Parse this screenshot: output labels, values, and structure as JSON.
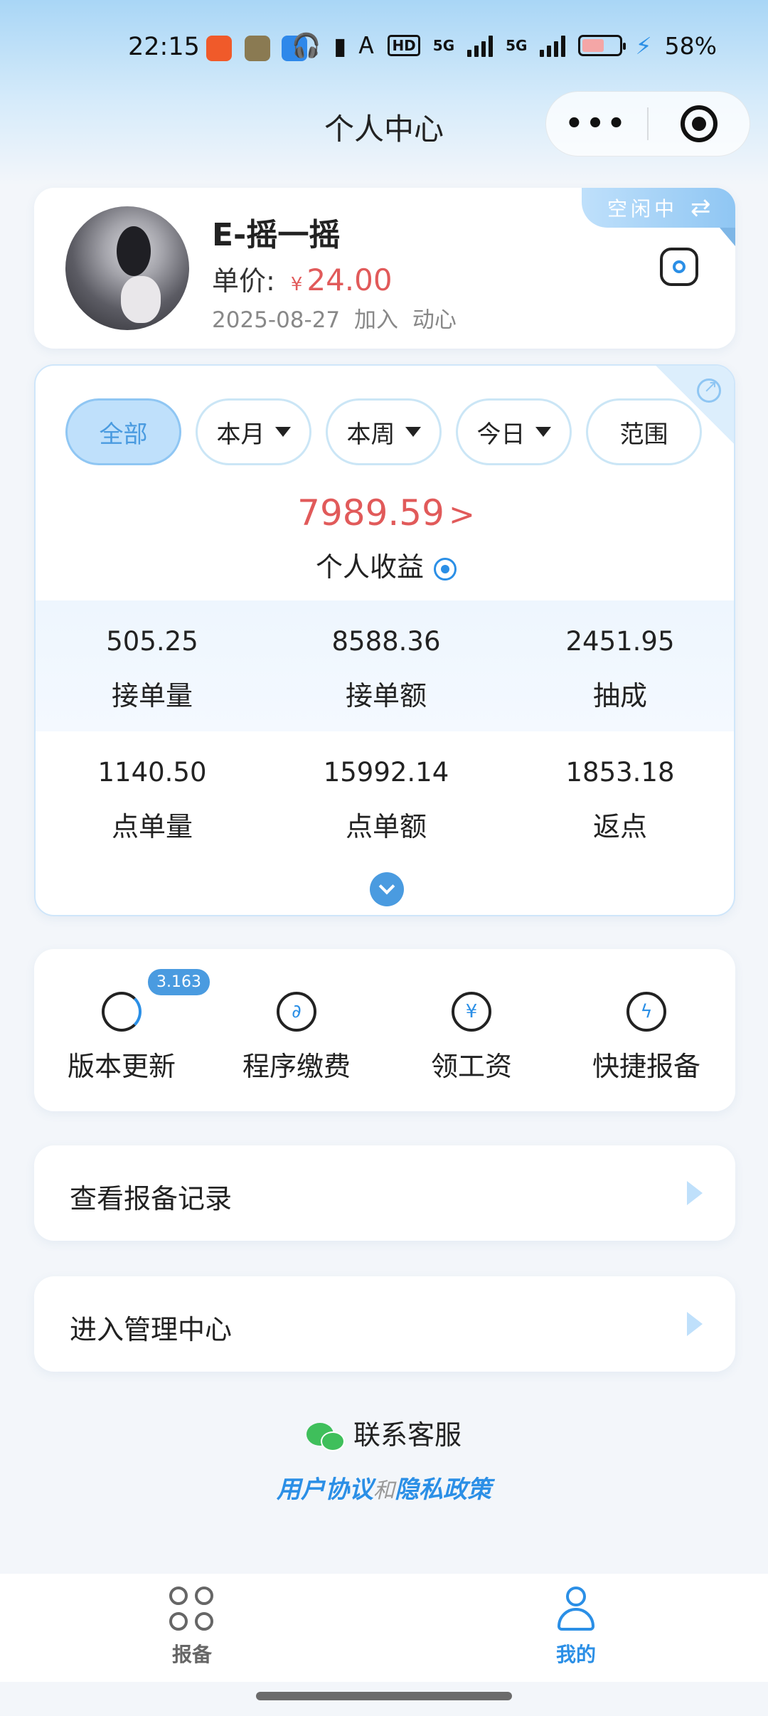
{
  "status_bar": {
    "time": "22:15",
    "network": "5G",
    "network2": "5G",
    "hd": "HD",
    "battery_pct": "58%",
    "battery_level": 0.58,
    "app_icon_colors": [
      "#f05a2a",
      "#8a7a52",
      "#2e88ea"
    ]
  },
  "nav": {
    "title": "个人中心",
    "more_label": "•••"
  },
  "profile": {
    "name": "E-摇一摇",
    "price_label": "单价:",
    "currency": "¥",
    "price": "24.00",
    "join_date": "2025-08-27",
    "join_text": "加入",
    "group": "动心",
    "status_tag": "空闲中",
    "switch_icon": "⇄"
  },
  "stats": {
    "filters": [
      {
        "label": "全部",
        "active": true,
        "dropdown": false
      },
      {
        "label": "本月",
        "active": false,
        "dropdown": true
      },
      {
        "label": "本周",
        "active": false,
        "dropdown": true
      },
      {
        "label": "今日",
        "active": false,
        "dropdown": true
      },
      {
        "label": "范围",
        "active": false,
        "dropdown": false
      }
    ],
    "total": "7989.59",
    "total_chevron": ">",
    "total_label": "个人收益",
    "grid_row1": [
      {
        "value": "505.25",
        "label": "接单量"
      },
      {
        "value": "8588.36",
        "label": "接单额"
      },
      {
        "value": "2451.95",
        "label": "抽成"
      }
    ],
    "grid_row2": [
      {
        "value": "1140.50",
        "label": "点单量"
      },
      {
        "value": "15992.14",
        "label": "点单额"
      },
      {
        "value": "1853.18",
        "label": "返点"
      }
    ]
  },
  "quick_actions": [
    {
      "label": "版本更新",
      "icon": "refresh-icon",
      "badge": "3.163"
    },
    {
      "label": "程序缴费",
      "icon": "mini-program-icon",
      "glyph": "∂"
    },
    {
      "label": "领工资",
      "icon": "wallet-yen-icon",
      "glyph": "¥"
    },
    {
      "label": "快捷报备",
      "icon": "lightning-icon",
      "glyph": "ϟ"
    }
  ],
  "menu": {
    "report_records": "查看报备记录",
    "admin_center": "进入管理中心"
  },
  "footer": {
    "contact": "联系客服",
    "user_agreement": "用户协议",
    "and": "和",
    "privacy_policy": "隐私政策"
  },
  "tabbar": {
    "tabs": [
      {
        "label": "报备",
        "active": false,
        "color": "#666666"
      },
      {
        "label": "我的",
        "active": true,
        "color": "#2b8fe6"
      }
    ]
  },
  "colors": {
    "accent": "#2b8fe6",
    "price_red": "#e15a5a",
    "tag_blue": "#8fc6f3",
    "wechat_green": "#3fbf5b"
  }
}
